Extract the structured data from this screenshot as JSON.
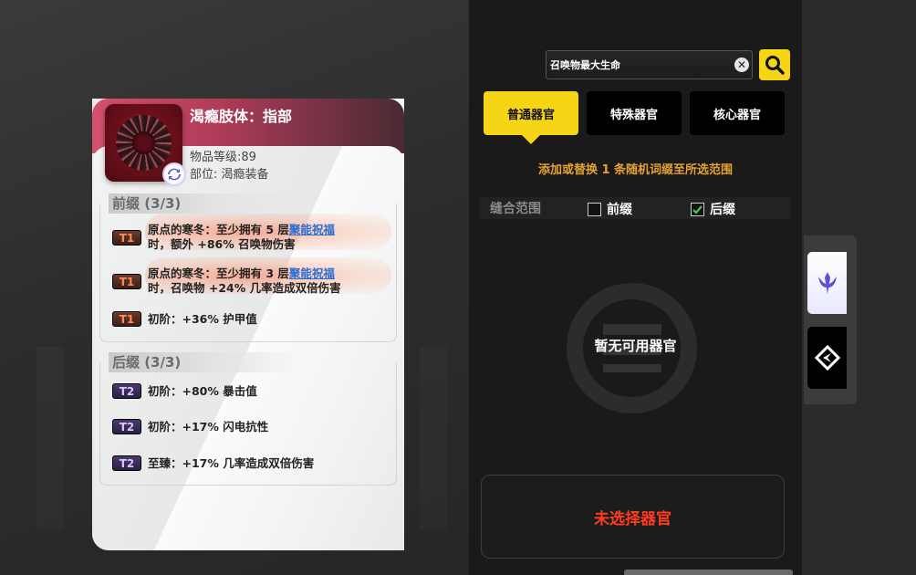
{
  "item": {
    "title": "渴瘾肢体：指部",
    "level": "物品等级:89",
    "slot": "部位: 渴瘾装备",
    "prefix_header": "前缀 (3/3)",
    "suffix_header": "后缀 (3/3)",
    "prefixes": [
      {
        "tier": "T1",
        "line1_prefix": "原点的寒冬：至少拥有 5 层",
        "link": "聚能祝福",
        "line2": "时，额外 +86% 召唤物伤害"
      },
      {
        "tier": "T1",
        "line1_prefix": "原点的寒冬：至少拥有 3 层",
        "link": "聚能祝福",
        "line2": "时，召唤物 +24% 几率造成双倍伤害"
      },
      {
        "tier": "T1",
        "text": "初阶：+36% 护甲值"
      }
    ],
    "suffixes": [
      {
        "tier": "T2",
        "text": "初阶：+80% 暴击值"
      },
      {
        "tier": "T2",
        "text": "初阶：+17% 闪电抗性"
      },
      {
        "tier": "T2",
        "text": "至臻：+17% 几率造成双倍伤害"
      }
    ]
  },
  "panel": {
    "search_value": "召唤物最大生命",
    "clear_glyph": "✕",
    "tabs": [
      {
        "label": "普通器官",
        "active": true
      },
      {
        "label": "特殊器官",
        "active": false
      },
      {
        "label": "核心器官",
        "active": false
      }
    ],
    "hint": "添加或替换 1 条随机词缀至所选范围",
    "range_label": "缝合范围",
    "prefix_checkbox": {
      "label": "前缀",
      "checked": false
    },
    "suffix_checkbox": {
      "label": "后缀",
      "checked": true
    },
    "empty_text": "暂无可用器官",
    "no_selection": "未选择器官"
  },
  "colors": {
    "accent_yellow": "#f5d516",
    "hint_orange": "#e5a233",
    "warning_red": "#ff3b1e",
    "card_header": "#b03c59"
  },
  "icons": {
    "search": "search-icon",
    "clear": "close-circle-icon",
    "sync": "sync-icon",
    "side_one": "trident-emblem-icon",
    "side_two": "compass-diamond-icon"
  }
}
